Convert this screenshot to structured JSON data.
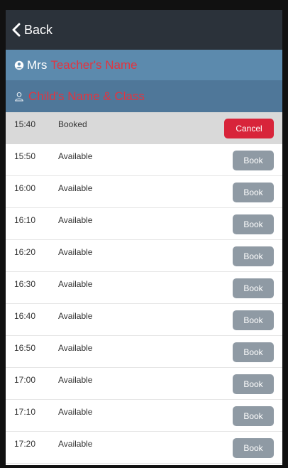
{
  "nav": {
    "back_label": "Back",
    "back_icon": "chevron-left-icon"
  },
  "teacher": {
    "icon": "user-circle-icon",
    "prefix": "Mrs",
    "name": "Teacher's Name"
  },
  "child": {
    "icon": "person-outline-icon",
    "name": "Child's Name & Class"
  },
  "colors": {
    "nav_bg": "#2b323a",
    "teacher_bg": "#5c8aad",
    "child_bg": "#4f7799",
    "accent_red": "#e3343f",
    "cancel_btn": "#d8243a",
    "book_btn": "#8f9aa4",
    "booked_row_bg": "#d9d9d9"
  },
  "slots": [
    {
      "time": "15:40",
      "status": "Booked",
      "action": "Cancel"
    },
    {
      "time": "15:50",
      "status": "Available",
      "action": "Book"
    },
    {
      "time": "16:00",
      "status": "Available",
      "action": "Book"
    },
    {
      "time": "16:10",
      "status": "Available",
      "action": "Book"
    },
    {
      "time": "16:20",
      "status": "Available",
      "action": "Book"
    },
    {
      "time": "16:30",
      "status": "Available",
      "action": "Book"
    },
    {
      "time": "16:40",
      "status": "Available",
      "action": "Book"
    },
    {
      "time": "16:50",
      "status": "Available",
      "action": "Book"
    },
    {
      "time": "17:00",
      "status": "Available",
      "action": "Book"
    },
    {
      "time": "17:10",
      "status": "Available",
      "action": "Book"
    },
    {
      "time": "17:20",
      "status": "Available",
      "action": "Book"
    }
  ]
}
